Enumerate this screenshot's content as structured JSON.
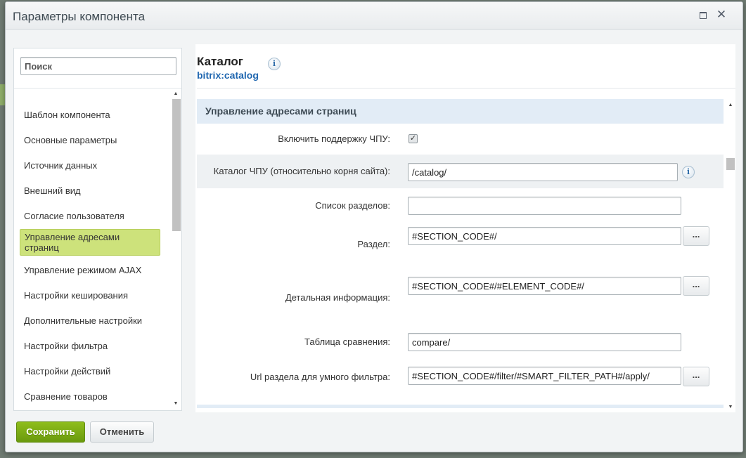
{
  "dialog": {
    "title": "Параметры компонента"
  },
  "sidebar": {
    "search_placeholder": "Поиск",
    "items": [
      {
        "label": "Шаблон компонента"
      },
      {
        "label": "Основные параметры"
      },
      {
        "label": "Источник данных"
      },
      {
        "label": "Внешний вид"
      },
      {
        "label": "Согласие пользователя"
      },
      {
        "label": "Управление адресами страниц",
        "active": true
      },
      {
        "label": "Управление режимом AJAX"
      },
      {
        "label": "Настройки кеширования"
      },
      {
        "label": "Дополнительные настройки"
      },
      {
        "label": "Настройки фильтра"
      },
      {
        "label": "Настройки действий"
      },
      {
        "label": "Сравнение товаров"
      }
    ]
  },
  "component": {
    "title": "Каталог",
    "code": "bitrix:catalog",
    "info_icon": "i"
  },
  "section": {
    "title": "Управление адресами страниц",
    "fields": {
      "sef_mode": {
        "label": "Включить поддержку ЧПУ:",
        "checked": true,
        "check_glyph": "✓"
      },
      "sef_folder": {
        "label": "Каталог ЧПУ (относительно корня сайта):",
        "value": "/catalog/"
      },
      "sections_list": {
        "label": "Список разделов:",
        "value": ""
      },
      "section": {
        "label": "Раздел:",
        "value": "#SECTION_CODE#/"
      },
      "element": {
        "label": "Детальная информация:",
        "value": "#SECTION_CODE#/#ELEMENT_CODE#/"
      },
      "compare": {
        "label": "Таблица сравнения:",
        "value": "compare/"
      },
      "smart_filter": {
        "label": "Url раздела для умного фильтра:",
        "value": "#SECTION_CODE#/filter/#SMART_FILTER_PATH#/apply/"
      }
    },
    "dots_label": "..."
  },
  "footer": {
    "save_label": "Сохранить",
    "cancel_label": "Отменить"
  }
}
